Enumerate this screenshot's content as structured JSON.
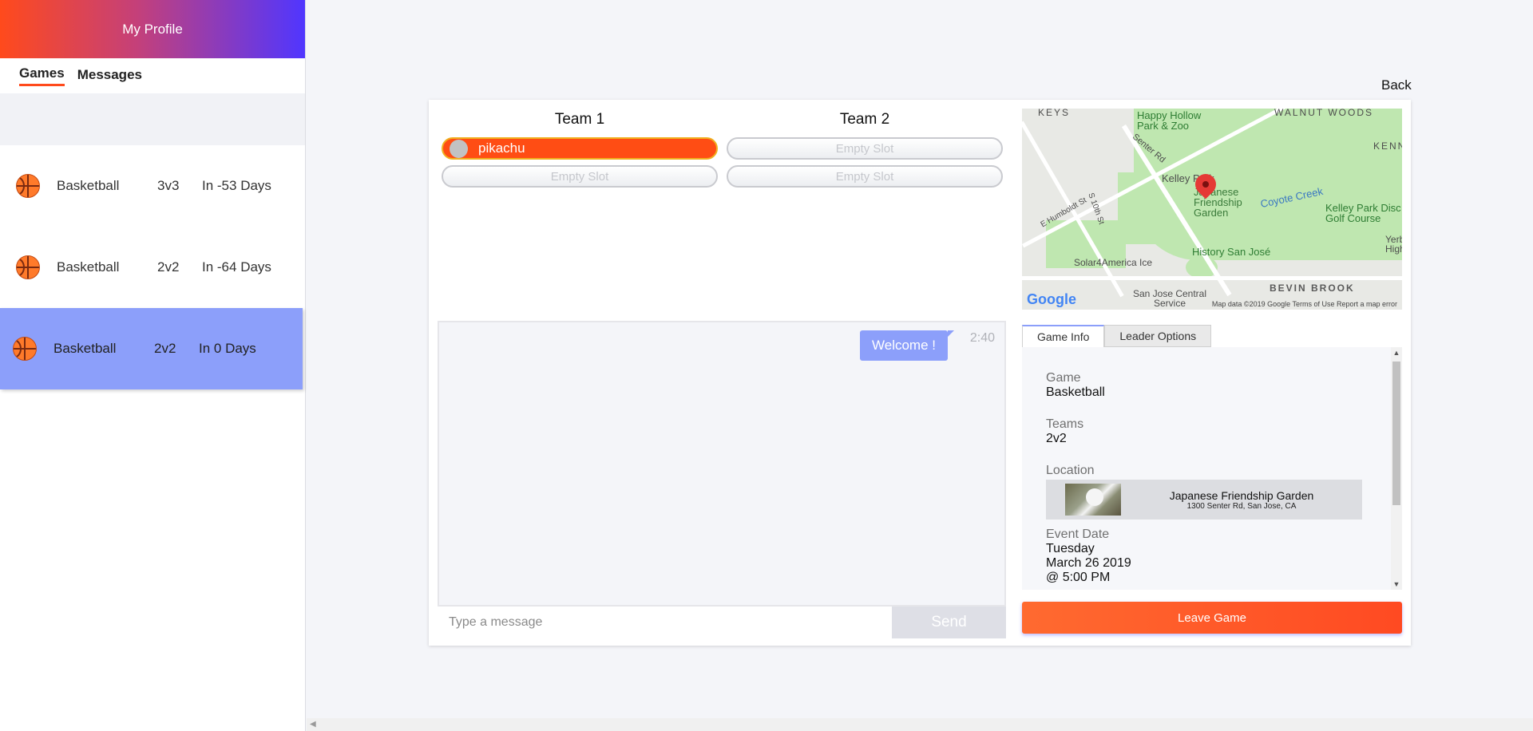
{
  "sidebar": {
    "profile_label": "My Profile",
    "tabs": [
      {
        "label": "Games"
      },
      {
        "label": "Messages"
      }
    ],
    "games": [
      {
        "name": "Basketball",
        "mode": "3v3",
        "days": "In -53 Days"
      },
      {
        "name": "Basketball",
        "mode": "2v2",
        "days": "In -64 Days"
      },
      {
        "name": "Basketball",
        "mode": "2v2",
        "days": "In 0 Days"
      }
    ]
  },
  "back_label": "Back",
  "teams": [
    {
      "title": "Team 1",
      "slots": [
        "pikachu",
        "Empty Slot"
      ]
    },
    {
      "title": "Team 2",
      "slots": [
        "Empty Slot",
        "Empty Slot"
      ]
    }
  ],
  "chat": {
    "messages": [
      {
        "text": "Welcome !",
        "time": "2:40"
      }
    ],
    "input_placeholder": "Type a message",
    "send_label": "Send"
  },
  "map": {
    "labels": [
      "KEYS",
      "WALNUT WOODS",
      "Happy Hollow Park & Zoo",
      "Senter Rd",
      "Kelley Park",
      "Japanese Friendship Garden",
      "Coyote Creek",
      "Kelley Park Disc Golf Course",
      "KENN",
      "S 10th St",
      "E Humboldt St",
      "History San José",
      "Solar4America Ice",
      "San Jose Central Service",
      "BEVIN BROOK",
      "Yerb High"
    ],
    "brand": "Google",
    "footer": "Map data ©2019 Google   Terms of Use   Report a map error"
  },
  "info_tabs": [
    "Game Info",
    "Leader Options"
  ],
  "game_info": {
    "game_label": "Game",
    "game_value": "Basketball",
    "teams_label": "Teams",
    "teams_value": "2v2",
    "location_label": "Location",
    "location_name": "Japanese Friendship Garden",
    "location_address": "1300 Senter Rd, San Jose, CA",
    "date_label": "Event Date",
    "date_day": "Tuesday",
    "date_full": "March 26 2019",
    "date_time": "@ 5:00 PM"
  },
  "leave_label": "Leave Game",
  "colors": {
    "accent": "#ff4a1c",
    "selected": "#8c9ffa",
    "brand_gradient_end": "#5036ff"
  }
}
